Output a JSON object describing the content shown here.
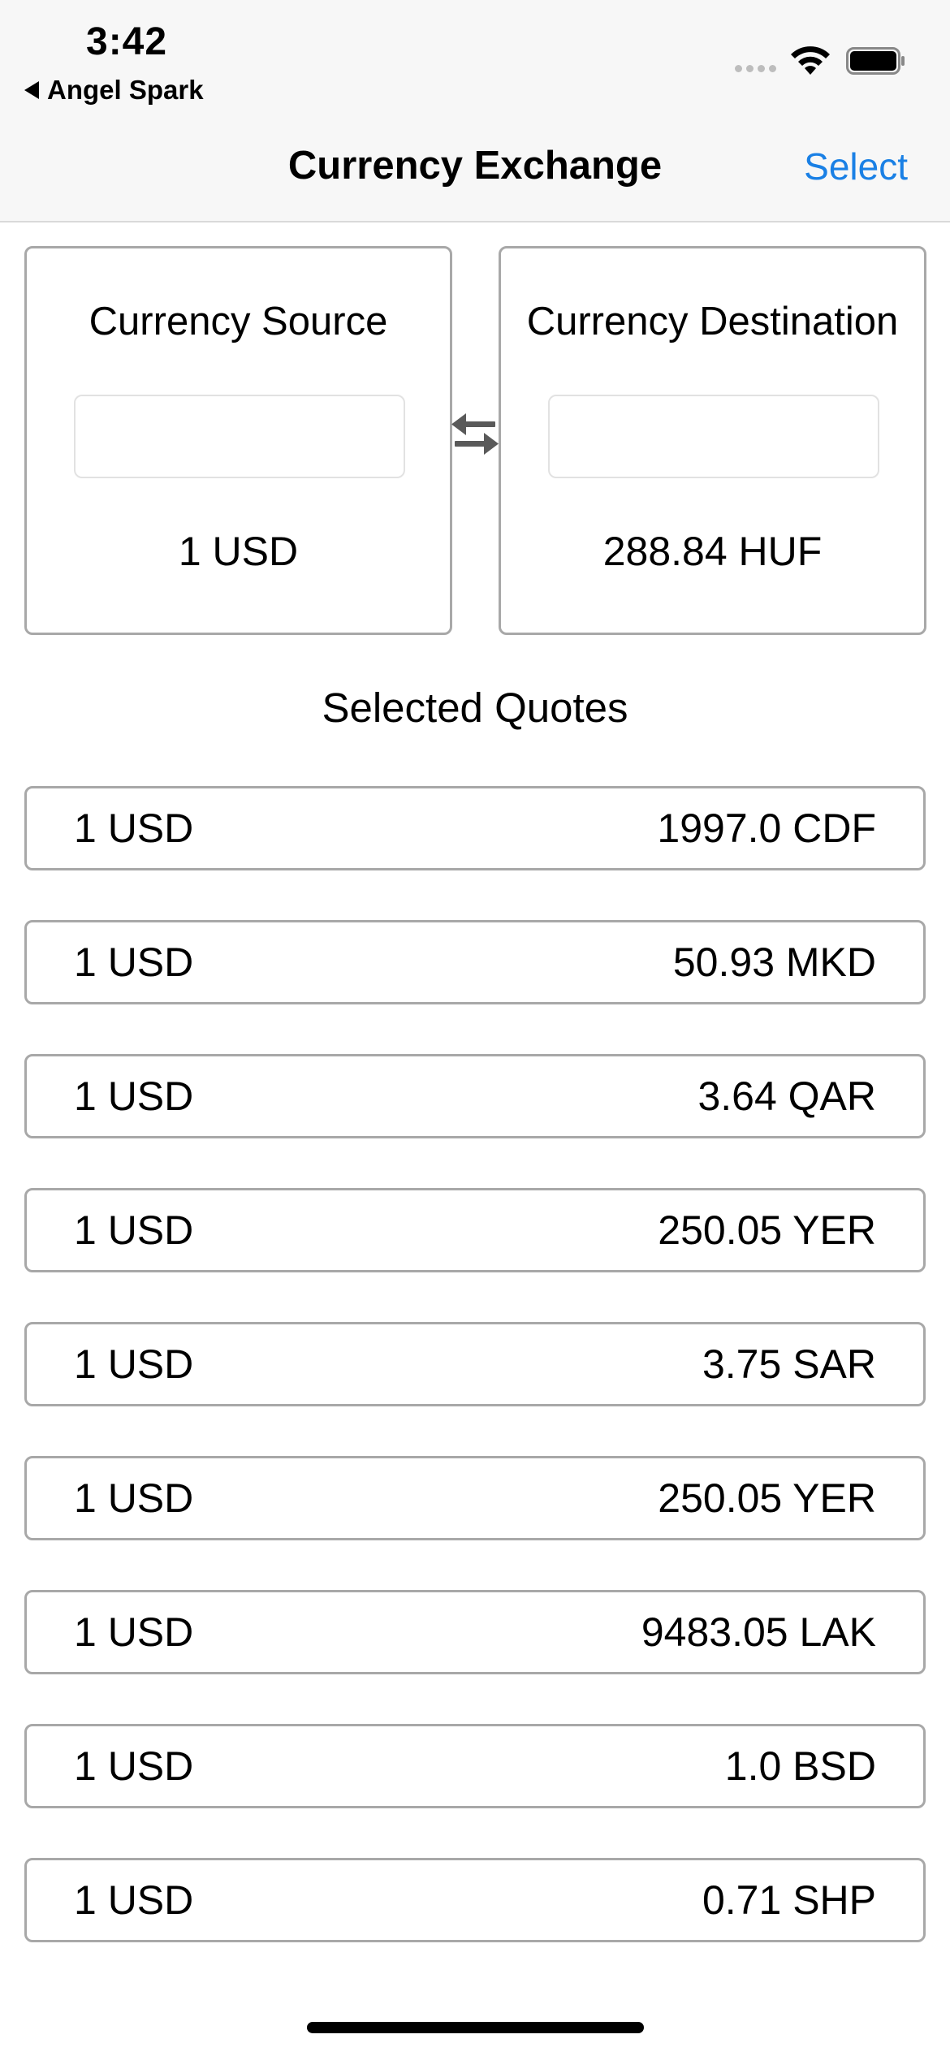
{
  "status_bar": {
    "time": "3:42",
    "back_app_label": "Angel Spark",
    "icons": [
      "signal-dots-icon",
      "wifi-icon",
      "battery-icon"
    ]
  },
  "nav": {
    "title": "Currency Exchange",
    "select_label": "Select",
    "accent_color": "#1a80e5"
  },
  "converter": {
    "source": {
      "title": "Currency Source",
      "input_value": "",
      "value": "1 USD"
    },
    "destination": {
      "title": "Currency Destination",
      "input_value": "",
      "value": "288.84 HUF"
    },
    "swap_icon": "swap-arrows-icon"
  },
  "quotes": {
    "title": "Selected Quotes",
    "items": [
      {
        "from": "1 USD",
        "to": "1997.0 CDF"
      },
      {
        "from": "1 USD",
        "to": "50.93 MKD"
      },
      {
        "from": "1 USD",
        "to": "3.64 QAR"
      },
      {
        "from": "1 USD",
        "to": "250.05 YER"
      },
      {
        "from": "1 USD",
        "to": "3.75 SAR"
      },
      {
        "from": "1 USD",
        "to": "250.05 YER"
      },
      {
        "from": "1 USD",
        "to": "9483.05 LAK"
      },
      {
        "from": "1 USD",
        "to": "1.0 BSD"
      },
      {
        "from": "1 USD",
        "to": "0.71 SHP"
      }
    ]
  }
}
